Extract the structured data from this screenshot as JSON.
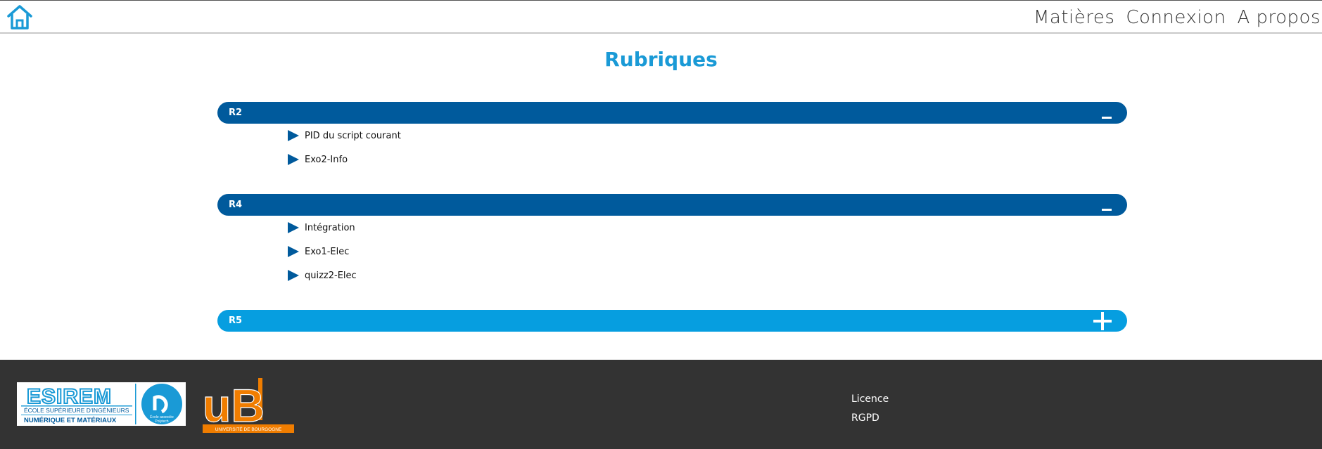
{
  "header": {
    "nav": [
      "Matières",
      "Connexion",
      "A propos"
    ],
    "home_icon": "home-icon"
  },
  "main": {
    "title": "Rubriques",
    "sections": [
      {
        "label": "R2",
        "expanded": true,
        "items": [
          "PID du script courant",
          "Exo2-Info"
        ]
      },
      {
        "label": "R4",
        "expanded": true,
        "items": [
          "Intégration",
          "Exo1-Elec",
          "quizz2-Elec"
        ]
      },
      {
        "label": "R5",
        "expanded": false,
        "items": []
      }
    ]
  },
  "footer": {
    "links": [
      "Licence",
      "RGPD"
    ],
    "esirem_logo": {
      "wordmark": "ESIREM",
      "line1": "ÉCOLE SUPÉRIEURE D'INGÉNIEURS",
      "line2": "NUMÉRIQUE ET MATÉRIAUX",
      "badge": "École associée Polytech"
    },
    "ub_logo": {
      "wordmark": "uB",
      "tagline": "UNIVERSITÉ DE BOURGOGNE"
    }
  },
  "colors": {
    "accent": "#1a9ad6",
    "section_open": "#005a9c",
    "section_closed": "#069ee0",
    "footer_bg": "#333333",
    "ub_orange": "#f07d00"
  }
}
